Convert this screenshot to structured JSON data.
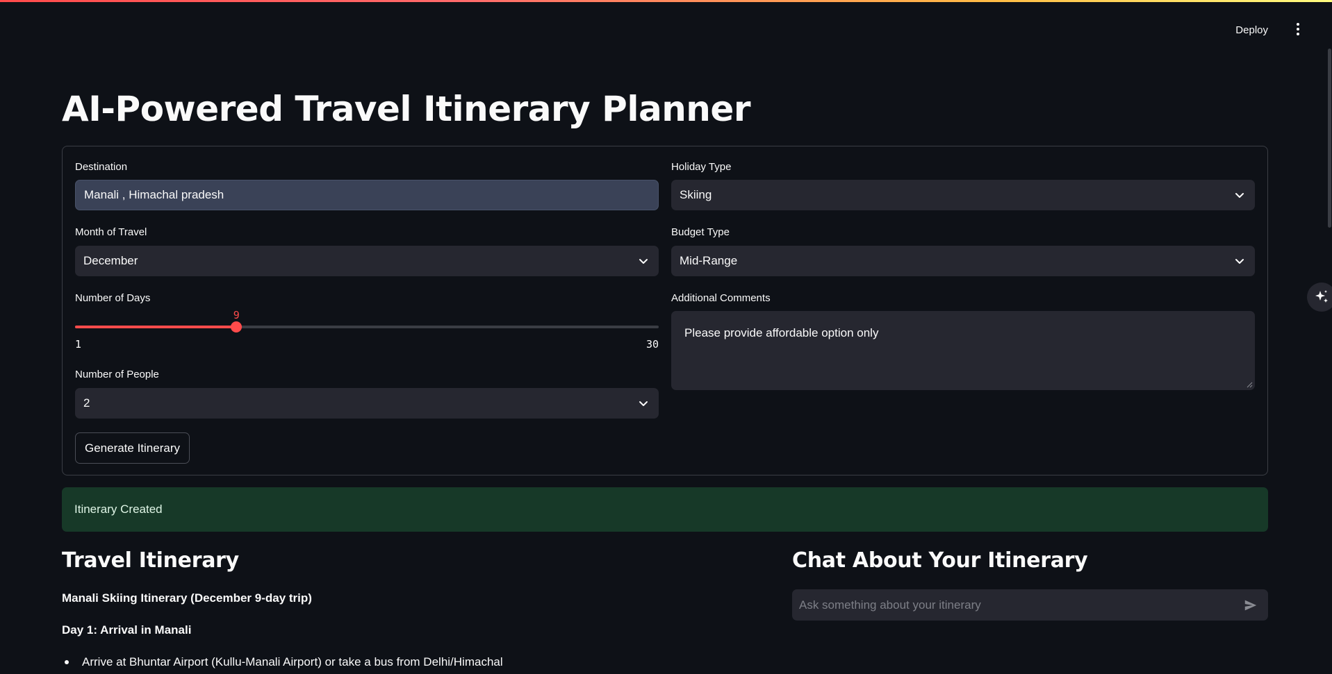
{
  "header": {
    "deploy_label": "Deploy",
    "menu_icon": "vertical-ellipsis-icon"
  },
  "page": {
    "title": "AI-Powered Travel Itinerary Planner"
  },
  "form": {
    "destination": {
      "label": "Destination",
      "value": "Manali , Himachal pradesh"
    },
    "holiday_type": {
      "label": "Holiday Type",
      "value": "Skiing"
    },
    "month": {
      "label": "Month of Travel",
      "value": "December"
    },
    "budget_type": {
      "label": "Budget Type",
      "value": "Mid-Range"
    },
    "days": {
      "label": "Number of Days",
      "value": 9,
      "value_label": "9",
      "min": 1,
      "max": 30,
      "min_label": "1",
      "max_label": "30"
    },
    "comments": {
      "label": "Additional Comments",
      "value": "Please provide affordable option only"
    },
    "people": {
      "label": "Number of People",
      "value": "2"
    },
    "generate_label": "Generate Itinerary"
  },
  "status": {
    "message": "Itinerary Created"
  },
  "itinerary": {
    "heading": "Travel Itinerary",
    "title": "Manali Skiing Itinerary (December 9-day trip)",
    "day1_heading": "Day 1: Arrival in Manali",
    "day1_bullets": [
      "Arrive at Bhuntar Airport (Kullu-Manali Airport) or take a bus from Delhi/Himachal"
    ]
  },
  "chat": {
    "heading": "Chat About Your Itinerary",
    "placeholder": "Ask something about your itinerary",
    "send_icon": "send-icon"
  },
  "colors": {
    "background": "#0e1117",
    "accent": "#ff4b4b",
    "input_bg": "#262730",
    "success_bg": "#173928"
  }
}
